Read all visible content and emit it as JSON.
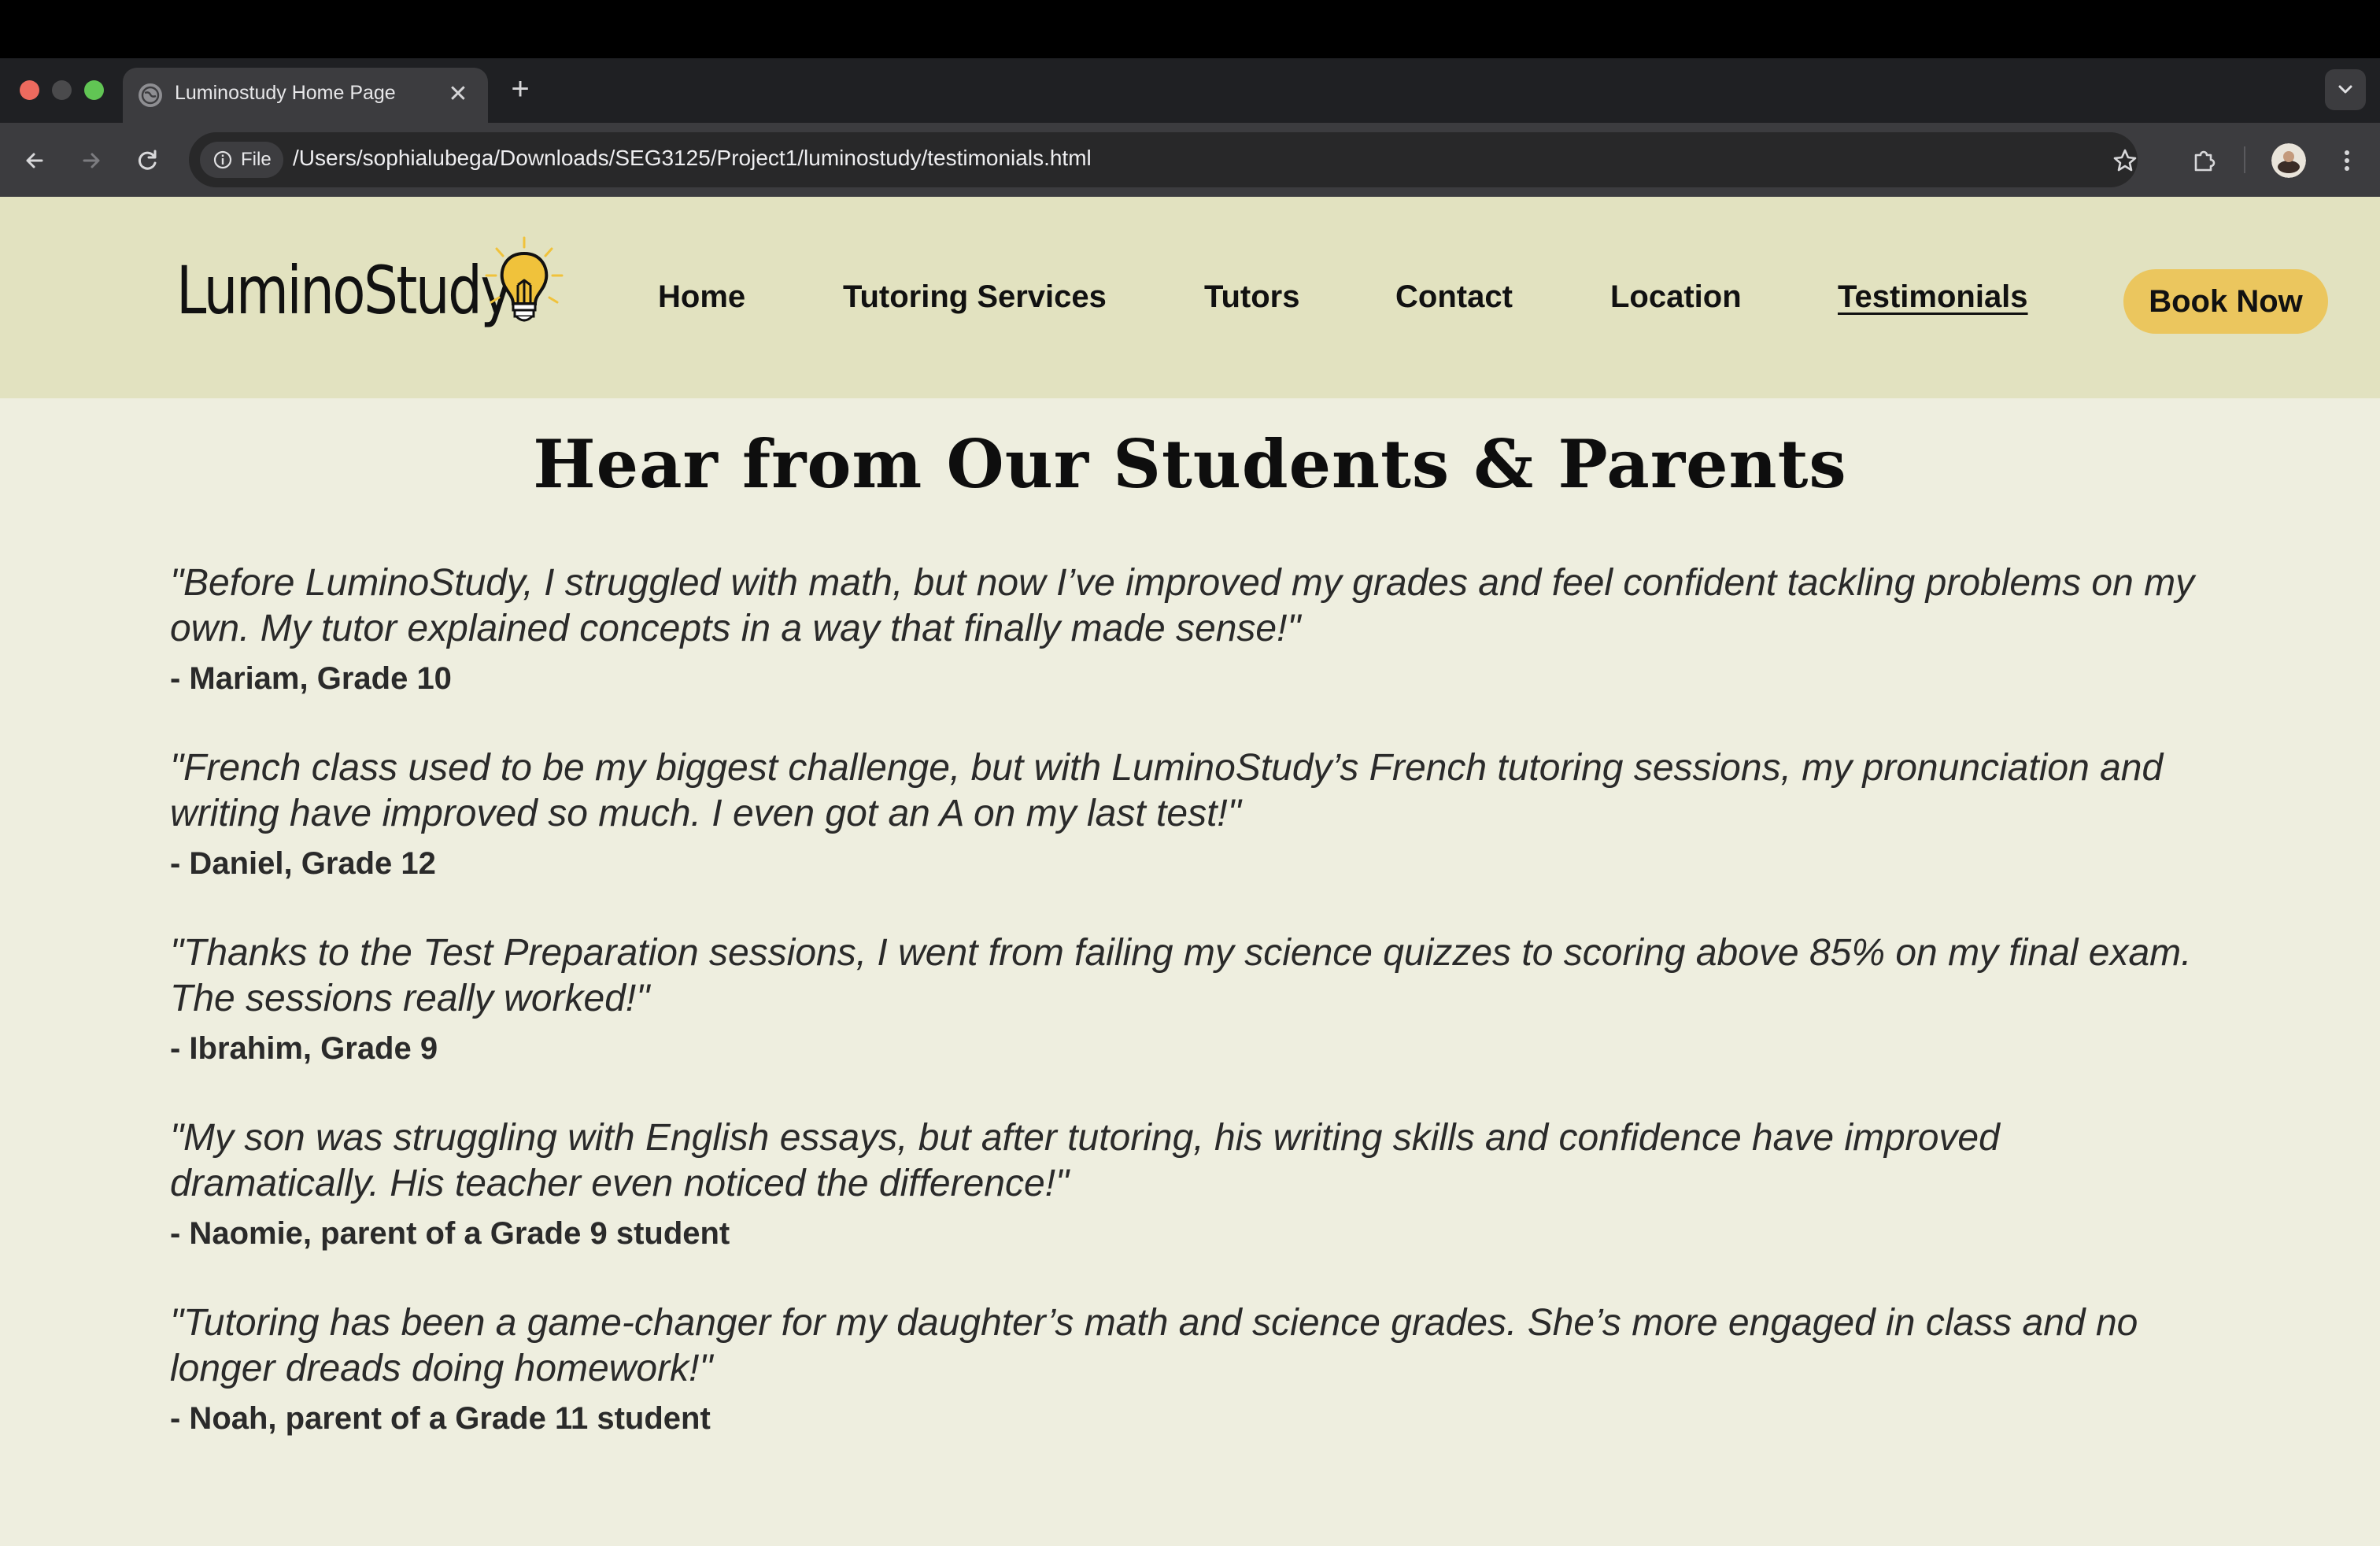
{
  "browser": {
    "tab_title": "Luminostudy Home Page",
    "tab_close": "✕",
    "new_tab": "+",
    "chip_label": "File",
    "url": "/Users/sophialubega/Downloads/SEG3125/Project1/luminostudy/testimonials.html",
    "icons": [
      "back-arrow-icon",
      "forward-arrow-icon",
      "reload-icon",
      "info-icon",
      "star-icon",
      "extensions-icon",
      "kebab-menu-icon",
      "chevron-down-icon",
      "globe-icon"
    ]
  },
  "site": {
    "logo_text": "LuminoStudy",
    "nav": [
      {
        "label": "Home"
      },
      {
        "label": "Tutoring Services"
      },
      {
        "label": "Tutors"
      },
      {
        "label": "Contact"
      },
      {
        "label": "Location"
      },
      {
        "label": "Testimonials",
        "active": true
      }
    ],
    "book_button": "Book Now",
    "colors": {
      "header_bg": "#e2e2c0",
      "page_bg": "#eeeedf",
      "button_bg": "#ebc65e",
      "bulb": "#f0c23b"
    }
  },
  "main": {
    "title": "Hear from Our Students & Parents",
    "testimonials": [
      {
        "quote": "\"Before LuminoStudy, I struggled with math, but now I’ve improved my grades and feel confident tackling problems on my own. My tutor explained concepts in a way that finally made sense!\"",
        "author": "- Mariam, Grade 10"
      },
      {
        "quote": "\"French class used to be my biggest challenge, but with LuminoStudy’s French tutoring sessions, my pronunciation and writing have improved so much. I even got an A on my last test!\"",
        "author": "- Daniel, Grade 12"
      },
      {
        "quote": "\"Thanks to the Test Preparation sessions, I went from failing my science quizzes to scoring above 85% on my final exam. The sessions really worked!\"",
        "author": "- Ibrahim, Grade 9"
      },
      {
        "quote": "\"My son was struggling with English essays, but after tutoring, his writing skills and confidence have improved dramatically. His teacher even noticed the difference!\"",
        "author": "- Naomie, parent of a Grade 9 student"
      },
      {
        "quote": "\"Tutoring has been a game-changer for my daughter’s math and science grades. She’s more engaged in class and no longer dreads doing homework!\"",
        "author": "- Noah, parent of a Grade 11 student"
      }
    ]
  }
}
